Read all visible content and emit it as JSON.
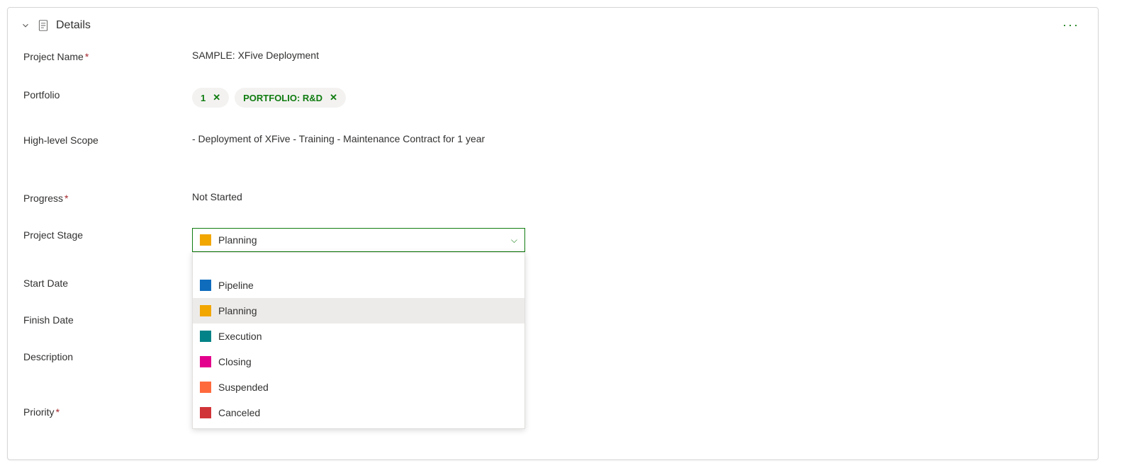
{
  "section": {
    "title": "Details",
    "more": "···"
  },
  "fields": {
    "projectName": {
      "label": "Project Name",
      "required": true,
      "value": "SAMPLE: XFive Deployment"
    },
    "portfolio": {
      "label": "Portfolio",
      "tags": [
        {
          "label": "1"
        },
        {
          "label": "PORTFOLIO: R&D"
        }
      ]
    },
    "scope": {
      "label": "High-level Scope",
      "value": "- Deployment of XFive - Training - Maintenance Contract for 1 year"
    },
    "progress": {
      "label": "Progress",
      "required": true,
      "value": "Not Started"
    },
    "projectStage": {
      "label": "Project Stage",
      "selected": {
        "label": "Planning",
        "color": "#f2a600"
      },
      "options": [
        {
          "label": "Pipeline",
          "color": "#0f6cbd"
        },
        {
          "label": "Planning",
          "color": "#f2a600"
        },
        {
          "label": "Execution",
          "color": "#038387"
        },
        {
          "label": "Closing",
          "color": "#e3008c"
        },
        {
          "label": "Suspended",
          "color": "#ff6a3d"
        },
        {
          "label": "Canceled",
          "color": "#d13438"
        }
      ]
    },
    "startDate": {
      "label": "Start Date"
    },
    "finishDate": {
      "label": "Finish Date"
    },
    "description": {
      "label": "Description"
    },
    "priority": {
      "label": "Priority",
      "required": true
    }
  }
}
